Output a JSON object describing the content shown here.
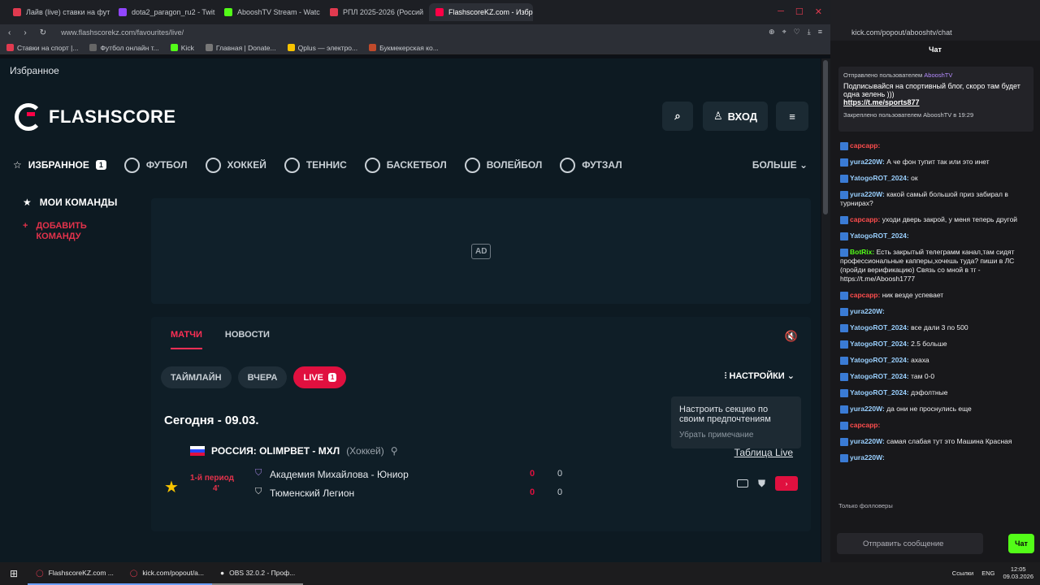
{
  "browser_tabs": [
    {
      "label": "Лайв (live) ставки на фут",
      "color": "#e03a4f"
    },
    {
      "label": "dota2_paragon_ru2 - Twit",
      "color": "#9146ff"
    },
    {
      "label": "AbooshTV Stream - Watc",
      "color": "#53fc18"
    },
    {
      "label": "РПЛ 2025-2026 (Россий",
      "color": "#e03a4f"
    },
    {
      "label": "FlashscoreKZ.com - Избр",
      "color": "#ff0046"
    }
  ],
  "address": "www.flashscorekz.com/favourites/live/",
  "bookmarks": [
    "Ставки на спорт |...",
    "Футбол онлайн т...",
    "Kick",
    "Главная | Donate...",
    "Qplus — электро...",
    "Букмекерская ко..."
  ],
  "page": {
    "title": "Избранное",
    "logo": "FLASHSCORE",
    "login": "ВХОД",
    "nav": [
      {
        "label": "ИЗБРАННОЕ",
        "badge": "1"
      },
      {
        "label": "ФУТБОЛ"
      },
      {
        "label": "ХОККЕЙ"
      },
      {
        "label": "ТЕННИС"
      },
      {
        "label": "БАСКЕТБОЛ"
      },
      {
        "label": "ВОЛЕЙБОЛ"
      },
      {
        "label": "ФУТЗАЛ"
      }
    ],
    "more": "БОЛЬШЕ",
    "sidebar": {
      "title": "МОИ КОМАНДЫ",
      "add": "ДОБАВИТЬ КОМАНДУ"
    },
    "ad": "AD",
    "tabs": [
      "МАТЧИ",
      "НОВОСТИ"
    ],
    "chips": [
      "ТАЙМЛАЙН",
      "ВЧЕРА",
      "LIVE"
    ],
    "live_count": "1",
    "settings": "НАСТРОЙКИ",
    "today": "Сегодня - 09.03.",
    "tooltip": {
      "text": "Настроить секцию по своим предпочтениям",
      "dismiss": "Убрать примечание"
    },
    "league": {
      "name": "РОССИЯ: OLIMPBET - МХЛ",
      "sport": "(Хоккей)",
      "table": "Таблица Live"
    },
    "match": {
      "period": "1-й период",
      "minute": "4'",
      "home": "Академия Михайлова - Юниор",
      "away": "Тюменский Легион",
      "home_score": "0",
      "away_score": "0",
      "home_p": "0",
      "away_p": "0"
    }
  },
  "chat": {
    "url": "kick.com/popout/abooshtv/chat",
    "title": "Чат",
    "pinned": {
      "by": "Отправлено пользователем",
      "user": "AbooshTV",
      "text": "Подписывайся на спортивный блог, скоро там будет одна зелень )))",
      "link": "https://t.me/sports877",
      "footer": "Закреплено пользователем AbooshTV в 19:29"
    },
    "messages": [
      {
        "user": "capcapp:",
        "text": "",
        "color": "#ff4d4d"
      },
      {
        "user": "yura220W:",
        "text": "А че фон тупит так или это инет",
        "color": "#9ad0ff"
      },
      {
        "user": "YatogoROT_2024:",
        "text": "ок",
        "color": "#9ad0ff"
      },
      {
        "user": "yura220W:",
        "text": "какой самый большой приз забирал в турнирах?",
        "color": "#9ad0ff"
      },
      {
        "user": "capcapp:",
        "text": "уходи дверь закрой, у меня теперь другой",
        "color": "#ff4d4d"
      },
      {
        "user": "YatogoROT_2024:",
        "text": "",
        "color": "#9ad0ff"
      },
      {
        "user": "BotRix:",
        "text": "Есть закрытый телеграмм канал,там сидят профессиональные капперы,хочешь туда? пиши в ЛС (пройди верификацию) Связь со мной в тг - https://t.me/Aboosh1777",
        "color": "#53fc18"
      },
      {
        "user": "capcapp:",
        "text": "ник везде успевает",
        "color": "#ff4d4d"
      },
      {
        "user": "yura220W:",
        "text": "",
        "color": "#9ad0ff"
      },
      {
        "user": "YatogoROT_2024:",
        "text": "все дали 3 по 500",
        "color": "#9ad0ff"
      },
      {
        "user": "YatogoROT_2024:",
        "text": "2.5 больше",
        "color": "#9ad0ff"
      },
      {
        "user": "YatogoROT_2024:",
        "text": "ахаха",
        "color": "#9ad0ff"
      },
      {
        "user": "YatogoROT_2024:",
        "text": "там 0-0",
        "color": "#9ad0ff"
      },
      {
        "user": "YatogoROT_2024:",
        "text": "дэфолтные",
        "color": "#9ad0ff"
      },
      {
        "user": "yura220W:",
        "text": "да они не проснулись еще",
        "color": "#9ad0ff"
      },
      {
        "user": "capcapp:",
        "text": "",
        "color": "#ff4d4d"
      },
      {
        "user": "yura220W:",
        "text": "самая слабая тут это Машина Красная",
        "color": "#9ad0ff"
      },
      {
        "user": "yura220W:",
        "text": "",
        "color": "#9ad0ff"
      }
    ],
    "followers": "Только фолловеры",
    "placeholder": "Отправить сообщение",
    "send": "Чат"
  },
  "taskbar": {
    "items": [
      "FlashscoreKZ.com ...",
      "kick.com/popout/a...",
      "OBS 32.0.2 - Проф..."
    ],
    "tray": "Ссылки",
    "lang": "ENG",
    "time": "12:05",
    "date": "09.03.2026"
  }
}
